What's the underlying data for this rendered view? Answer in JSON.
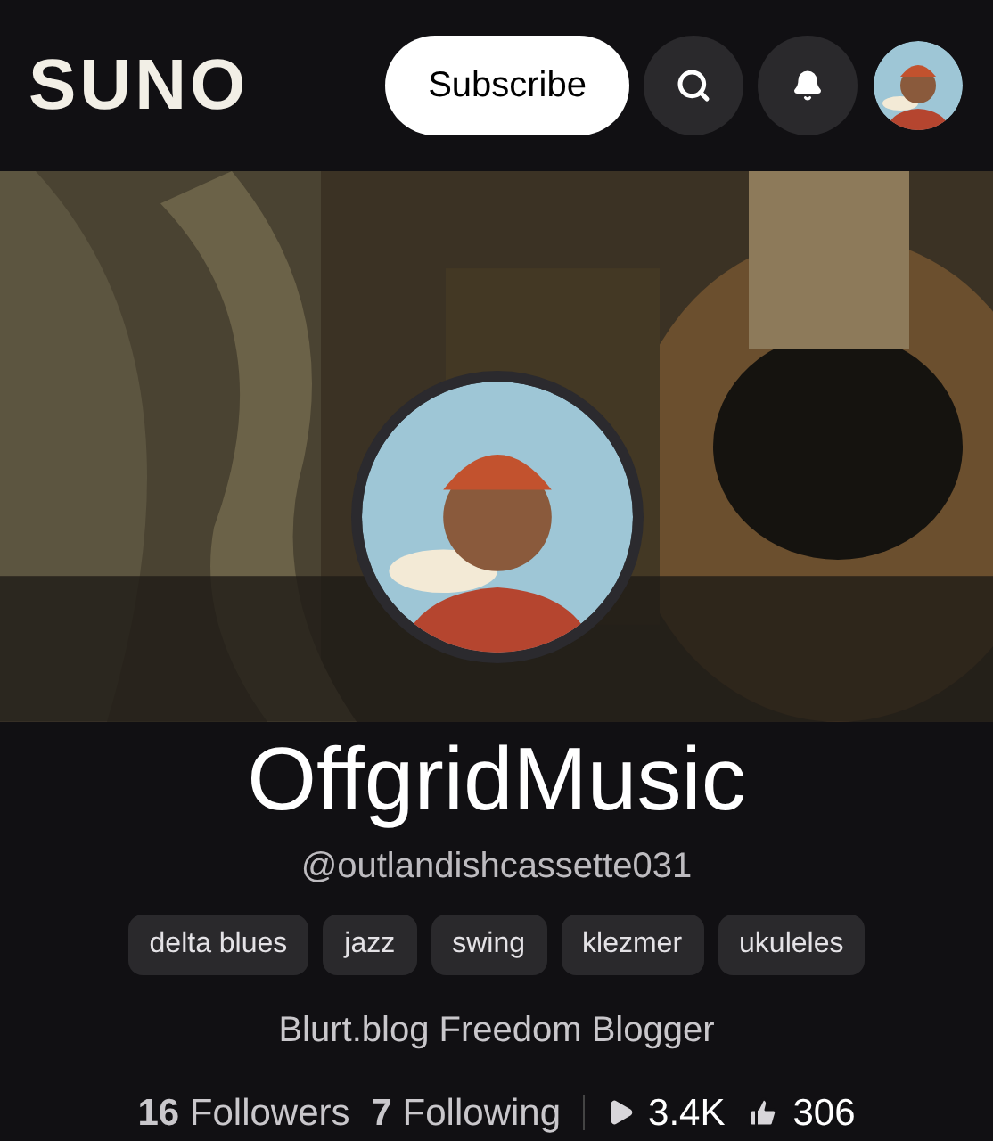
{
  "header": {
    "logo": "SUNO",
    "subscribe_button": "Subscribe"
  },
  "profile": {
    "name": "OffgridMusic",
    "handle": "@outlandishcassette031",
    "tags": [
      "delta blues",
      "jazz",
      "swing",
      "klezmer",
      "ukuleles"
    ],
    "bio": "Blurt.blog Freedom Blogger",
    "follow_stats": [
      "**16** Followers",
      "**7** Following"
    ],
    "plays": "3.4K",
    "likes": "306"
  }
}
